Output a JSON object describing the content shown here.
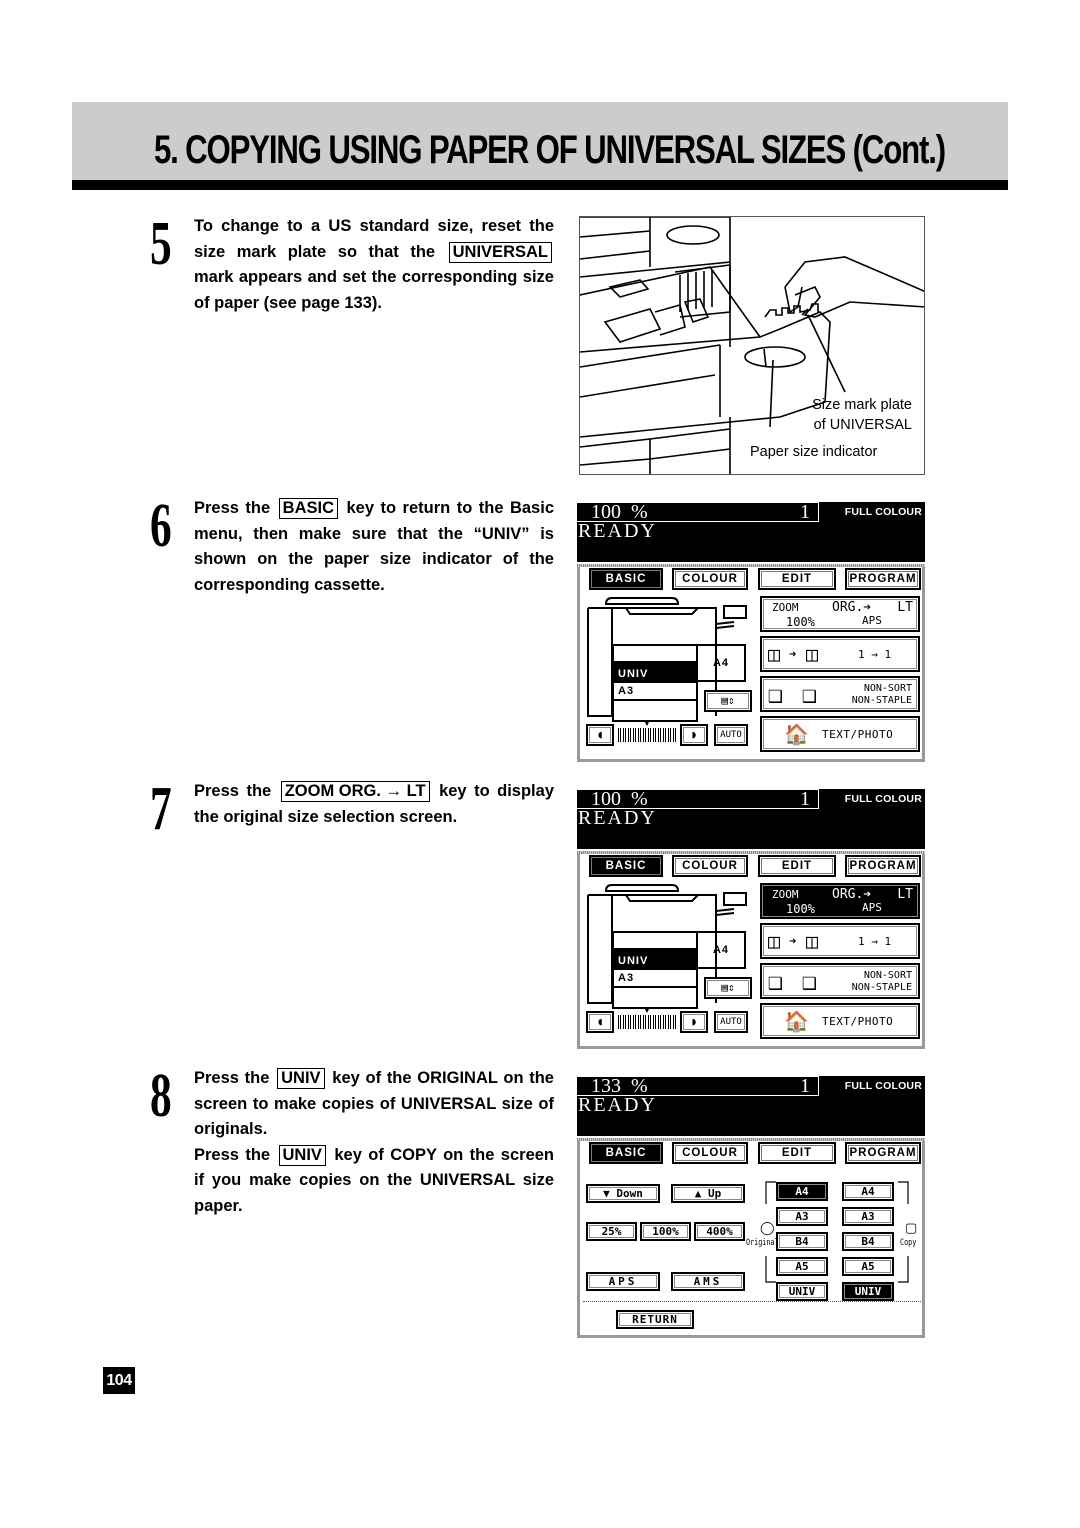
{
  "header": {
    "title": "5. COPYING USING PAPER OF UNIVERSAL SIZES (Cont.)"
  },
  "steps": [
    {
      "number": "5",
      "parts": [
        "To change to a US standard size, reset the size mark plate so that the",
        "UNIVERSAL",
        "mark appears and set the corresponding size of paper (see page 133)."
      ]
    },
    {
      "number": "6",
      "parts": [
        "Press the",
        "BASIC",
        "key to return to the Basic menu, then make sure that the “UNIV” is shown on the paper size indicator of the corresponding cassette."
      ]
    },
    {
      "number": "7",
      "parts": [
        "Press the",
        "ZOOM ORG. → LT",
        "key to display the original size selection screen."
      ]
    },
    {
      "number": "8",
      "parts": [
        "Press the",
        "UNIV",
        "key of the ORIGINAL on the screen to make copies of UNIVERSAL size of originals.",
        "Press the",
        "UNIV",
        "key of COPY on the screen if you make copies on the UNIVERSAL size paper."
      ]
    }
  ],
  "illustration": {
    "callout_plate_line1": "Size mark plate",
    "callout_plate_line2": "of UNIVERSAL",
    "callout_indicator": "Paper size indicator"
  },
  "panels": [
    {
      "zoom_pct": "100  %",
      "count": "1",
      "mode": "FULL COLOUR",
      "status": "READY",
      "tabs": [
        "BASIC",
        "COLOUR",
        "EDIT",
        "PROGRAM"
      ],
      "zoom_key": {
        "zoom": "ZOOM",
        "zoom_val": "100%",
        "org": "ORG.➔",
        "lt": "LT",
        "aps": "APS",
        "highlighted": false
      },
      "duplex": "1 → 1",
      "sort_line1": "NON-SORT",
      "sort_line2": "NON-STAPLE",
      "image_mode": "TEXT/PHOTO",
      "trays": [
        "",
        "UNIV",
        "A3",
        ""
      ],
      "bypass": "A4",
      "auto": "AUTO"
    },
    {
      "zoom_pct": "100  %",
      "count": "1",
      "mode": "FULL COLOUR",
      "status": "READY",
      "tabs": [
        "BASIC",
        "COLOUR",
        "EDIT",
        "PROGRAM"
      ],
      "zoom_key": {
        "zoom": "ZOOM",
        "zoom_val": "100%",
        "org": "ORG.➔",
        "lt": "LT",
        "aps": "APS",
        "highlighted": true
      },
      "duplex": "1 → 1",
      "sort_line1": "NON-SORT",
      "sort_line2": "NON-STAPLE",
      "image_mode": "TEXT/PHOTO",
      "trays": [
        "",
        "UNIV",
        "A3",
        ""
      ],
      "bypass": "A4",
      "auto": "AUTO"
    },
    {
      "zoom_pct": "133  %",
      "count": "1",
      "mode": "FULL COLOUR",
      "status": "READY",
      "tabs": [
        "BASIC",
        "COLOUR",
        "EDIT",
        "PROGRAM"
      ],
      "down": "Down",
      "up": "Up",
      "presets": [
        "25%",
        "100%",
        "400%"
      ],
      "aps": "APS",
      "ams": "AMS",
      "original_label": "Original",
      "copy_label": "Copy",
      "original_sizes": [
        "A4",
        "A3",
        "B4",
        "A5",
        "UNIV"
      ],
      "copy_sizes": [
        "A4",
        "A3",
        "B4",
        "A5",
        "UNIV"
      ],
      "original_selected": "A4",
      "copy_selected": "UNIV",
      "return": "RETURN"
    }
  ],
  "page_number": "104"
}
